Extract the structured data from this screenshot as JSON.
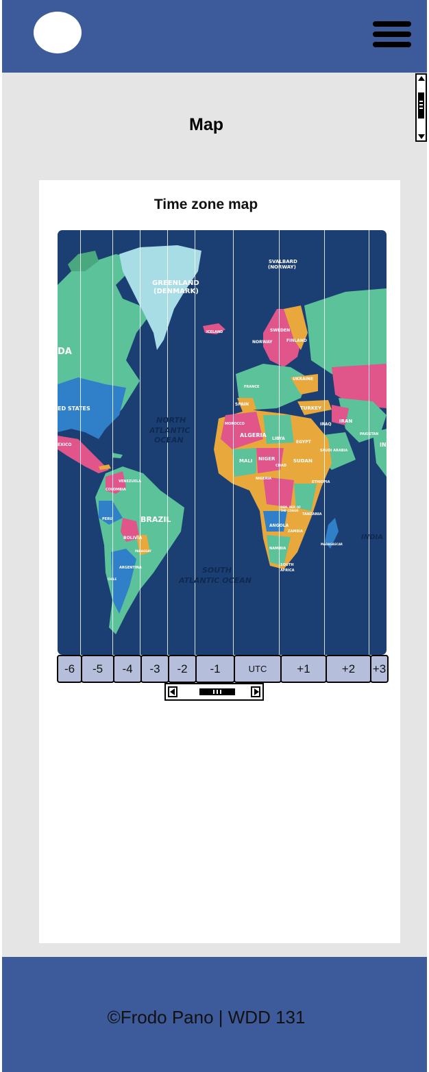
{
  "header": {
    "logo_icon": "circle-logo-icon",
    "menu_icon": "hamburger-menu-icon"
  },
  "main": {
    "page_title": "Map",
    "card_title": "Time zone map",
    "map_labels": {
      "greenland": "GREENLAND",
      "denmark": "(DENMARK)",
      "svalbard": "SVALBARD",
      "norway_sv": "(NORWAY)",
      "iceland": "ICELAND",
      "sweden": "SWEDEN",
      "norway": "NORWAY",
      "finland": "FINLAND",
      "ukraine": "UKRAINE",
      "france": "FRANCE",
      "spain": "SPAIN",
      "turkey": "TURKEY",
      "united_states": "ED STATES",
      "canada": "DA",
      "north_atlantic_1": "NORTH",
      "north_atlantic_2": "ATLANTIC",
      "north_atlantic_3": "OCEAN",
      "morocco": "MOROCCO",
      "algeria": "ALGERIA",
      "libya": "LIBYA",
      "egypt": "EGYPT",
      "iraq": "IRAQ",
      "iran": "IRAN",
      "mexico": "EXICO",
      "saudi": "SAUDI ARABIA",
      "mali": "MALI",
      "niger": "NIGER",
      "chad": "CHAD",
      "sudan": "SUDAN",
      "venezuela": "VENEZUELA",
      "colombia": "COLOMBIA",
      "nigeria": "NIGERIA",
      "ethiopia": "ETHIOPIA",
      "brazil": "BRAZIL",
      "peru": "PERU",
      "drc": "DEM. REP. OF THE CONGO",
      "tanzania": "TANZANIA",
      "angola": "ANGOLA",
      "zambia": "ZAMBIA",
      "bolivia": "BOLIVIA",
      "paraguay": "PARAGUAY",
      "argentina": "ARGENTINA",
      "namibia": "NAMIBIA",
      "south_africa_1": "SOUTH",
      "south_africa_2": "AFRICA",
      "madagascar": "MADAGASCAR",
      "chile": "CHILE",
      "south_atlantic_1": "SOUTH",
      "south_atlantic_2": "ATLANTIC OCEAN",
      "india": "IN",
      "indian_ocean": "INDIA",
      "pakistan": "PAKISTAN"
    },
    "zones": [
      {
        "label": "-6",
        "w": 35
      },
      {
        "label": "-5",
        "w": 49
      },
      {
        "label": "-4",
        "w": 42
      },
      {
        "label": "-3",
        "w": 42
      },
      {
        "label": "-2",
        "w": 42
      },
      {
        "label": "-1",
        "w": 58
      },
      {
        "label": "UTC",
        "w": 70
      },
      {
        "label": "+1",
        "w": 68
      },
      {
        "label": "+2",
        "w": 67
      },
      {
        "label": "+3",
        "w": 27
      }
    ]
  },
  "footer": {
    "text": "©Frodo Pano | WDD 131"
  },
  "colors": {
    "brand": "#3d5a9a",
    "ocean": "#1c3f73",
    "zone_button": "#b5bfdb",
    "background": "#e5e5e5"
  }
}
